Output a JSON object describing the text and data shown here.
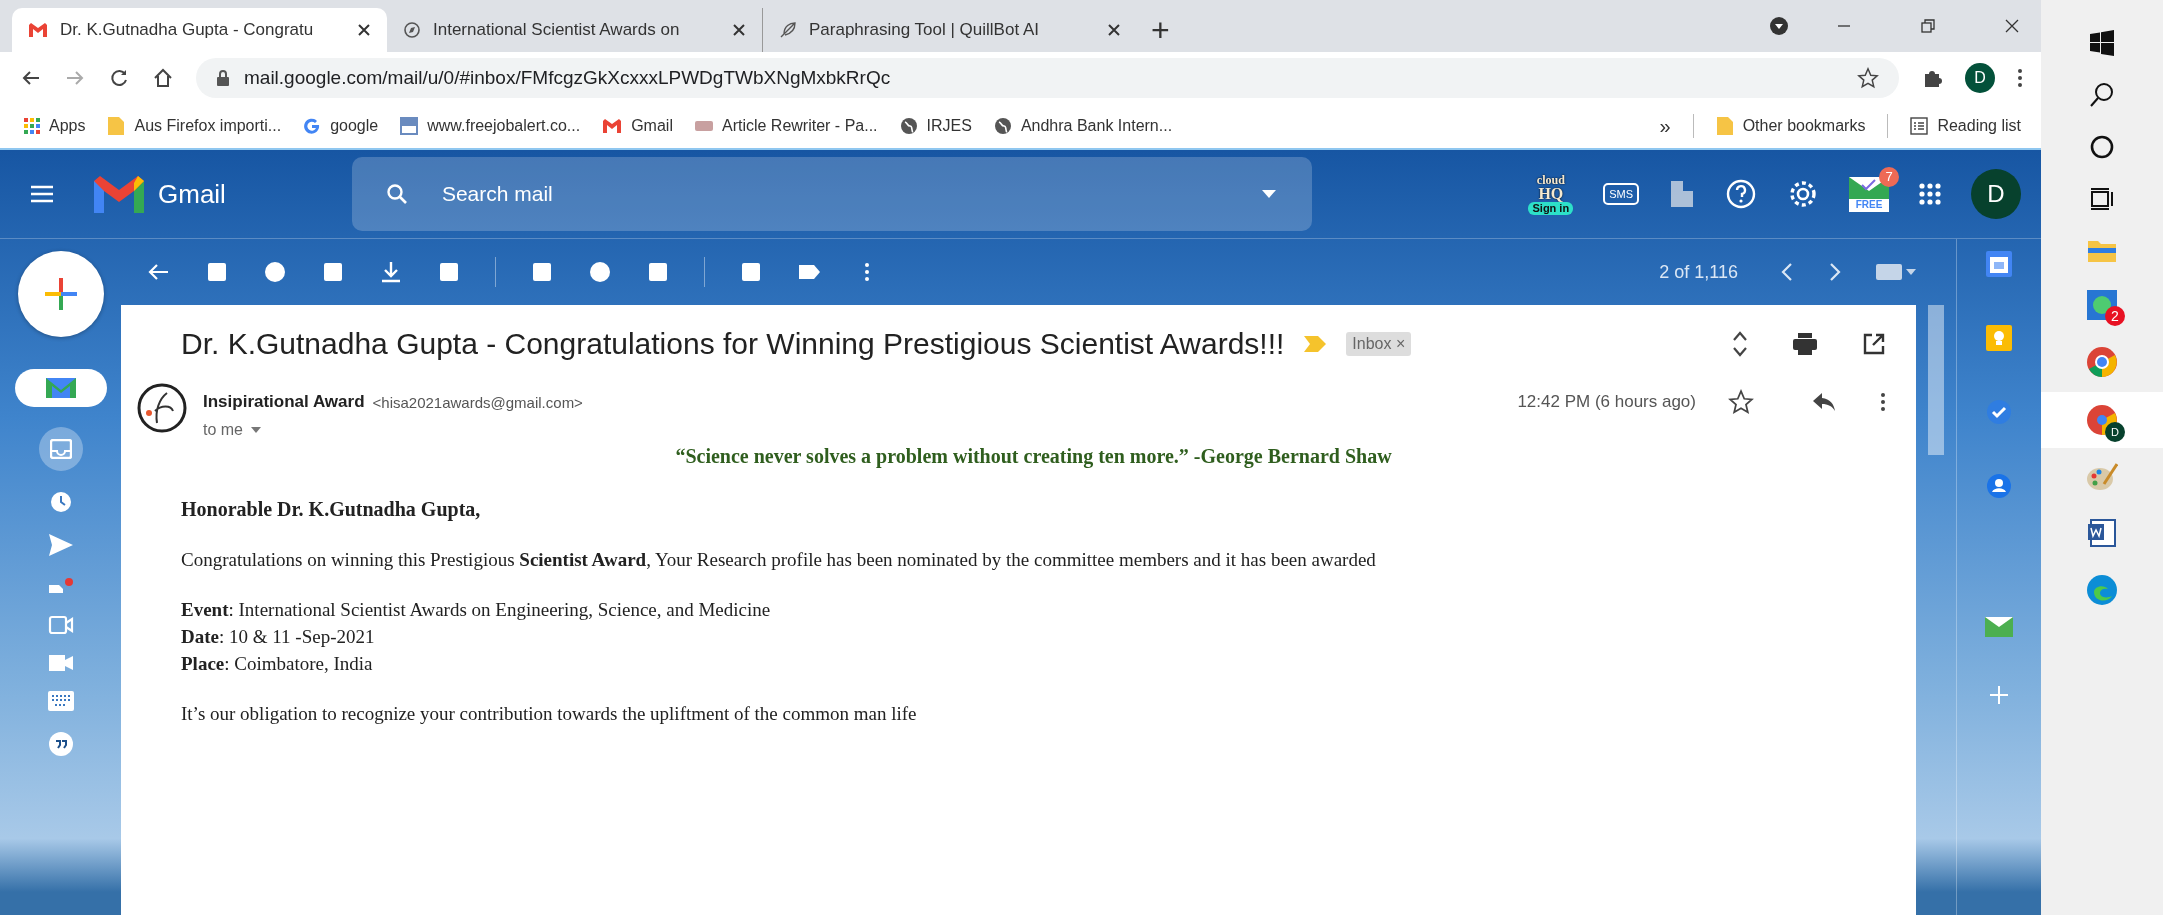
{
  "browser": {
    "tabs": [
      {
        "title": "Dr. K.Gutnadha Gupta - Congratu",
        "selected": true
      },
      {
        "title": "International Scientist Awards on",
        "selected": false
      },
      {
        "title": "Paraphrasing Tool | QuillBot AI",
        "selected": false
      }
    ],
    "new_tab": "+",
    "address": "mail.google.com/mail/u/0/#inbox/FMfcgzGkXcxxxLPWDgTWbXNgMxbkRrQc",
    "profile_initial": "D",
    "bookmarks": [
      {
        "label": "Apps",
        "kind": "apps"
      },
      {
        "label": "Aus Firefox importi...",
        "kind": "folder"
      },
      {
        "label": "google",
        "kind": "google"
      },
      {
        "label": "www.freejobalert.co...",
        "kind": "site"
      },
      {
        "label": "Gmail",
        "kind": "gmail"
      },
      {
        "label": "Article Rewriter - Pa...",
        "kind": "sst"
      },
      {
        "label": "IRJES",
        "kind": "globe"
      },
      {
        "label": "Andhra Bank Intern...",
        "kind": "globe"
      }
    ],
    "overflow": "»",
    "other_bookmarks": "Other bookmarks",
    "reading_list": "Reading list"
  },
  "gmail": {
    "logo_text": "Gmail",
    "search": {
      "placeholder": "Search mail"
    },
    "cloudhq": {
      "line_1": "cloud",
      "line_2": "HQ",
      "sign_in": "Sign in"
    },
    "sms": "SMS",
    "free": "FREE",
    "free_badge": "7",
    "account_initial": "D",
    "pagination": "2 of 1,116",
    "email": {
      "subject": "Dr. K.Gutnadha Gupta - Congratulations for Winning Prestigious Scientist Awards!!!",
      "label": "Inbox ×",
      "sender_name": "Insipirational Award",
      "sender_email": "<hisa2021awards@gmail.com>",
      "recipient": "to me",
      "time": "12:42 PM (6 hours ago)",
      "quote": "“Science never solves a problem without creating ten more.” -George Bernard Shaw",
      "greeting": "Honorable Dr. K.Gutnadha Gupta,",
      "paragraphs": [
        [
          "Congratulations on winning this Prestigious **Scientist Award**, Your Research profile has been nominated by the committee members and it has been awarded"
        ],
        [
          "**Event**: International Scientist Awards on Engineering, Science, and Medicine",
          "**Date**: 10 & 11 -Sep-2021",
          "**Place**: Coimbatore, India"
        ],
        [
          "It’s our obligation to recognize your contribution towards the upliftment of the common man life"
        ]
      ]
    }
  },
  "taskbar": {
    "whatsapp_badge": "2",
    "chrome_profile": "D"
  }
}
